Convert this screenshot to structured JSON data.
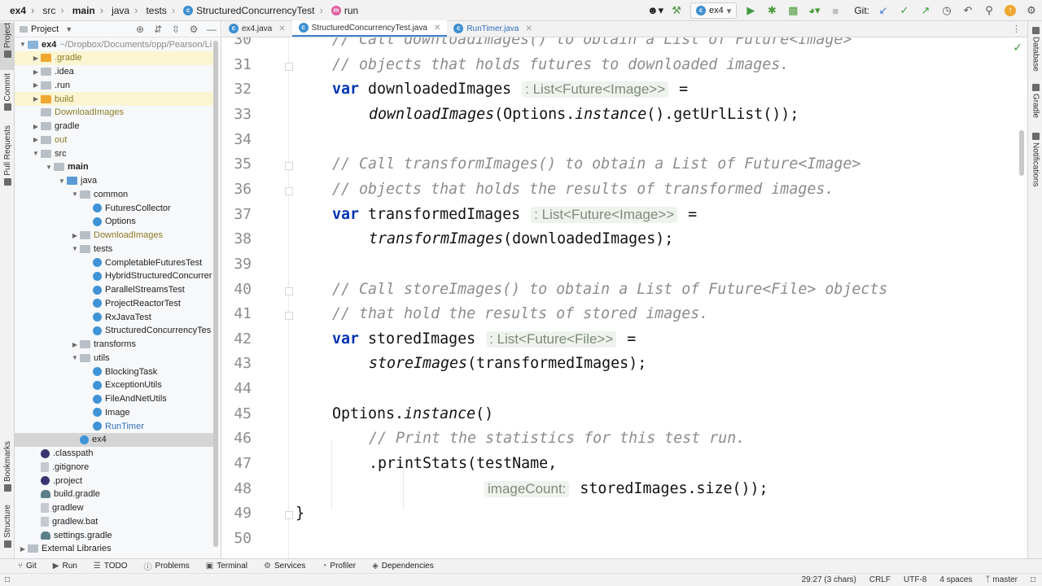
{
  "breadcrumb": [
    "ex4",
    "src",
    "main",
    "java",
    "tests",
    "StructuredConcurrencyTest",
    "run"
  ],
  "toolbar": {
    "run_config": "ex4",
    "git_label": "Git:",
    "icons": [
      "user-icon",
      "hammer-icon",
      "run-icon",
      "debug-icon",
      "coverage-icon",
      "profile-icon",
      "stop-icon",
      "git-update-icon",
      "git-commit-icon",
      "git-push-icon",
      "history-icon",
      "rollback-icon",
      "search-icon",
      "update-icon",
      "settings-icon"
    ]
  },
  "left_strip": [
    "Project",
    "Commit",
    "Pull Requests",
    "Bookmarks",
    "Structure"
  ],
  "right_strip": [
    "Database",
    "Gradle",
    "Notifications"
  ],
  "project_panel": {
    "title": "Project",
    "tree": [
      {
        "label": "ex4",
        "extra": "~/Dropbox/Documents/opp/Pearson/Li",
        "depth": 0,
        "arrow": "open",
        "icon": "folder-blue",
        "bold": true
      },
      {
        "label": ".gradle",
        "depth": 1,
        "arrow": "closed",
        "icon": "folder-orange",
        "style": "olive",
        "hl": true
      },
      {
        "label": ".idea",
        "depth": 1,
        "arrow": "closed",
        "icon": "folder-gray"
      },
      {
        "label": ".run",
        "depth": 1,
        "arrow": "closed",
        "icon": "folder-gray"
      },
      {
        "label": "build",
        "depth": 1,
        "arrow": "closed",
        "icon": "folder-orange",
        "style": "olive",
        "hl": true
      },
      {
        "label": "DownloadImages",
        "depth": 1,
        "arrow": "none",
        "icon": "folder-gray",
        "style": "olive"
      },
      {
        "label": "gradle",
        "depth": 1,
        "arrow": "closed",
        "icon": "folder-gray"
      },
      {
        "label": "out",
        "depth": 1,
        "arrow": "closed",
        "icon": "folder-gray",
        "style": "olive"
      },
      {
        "label": "src",
        "depth": 1,
        "arrow": "open",
        "icon": "folder-gray"
      },
      {
        "label": "main",
        "depth": 2,
        "arrow": "open",
        "icon": "folder-gray",
        "bold": true
      },
      {
        "label": "java",
        "depth": 3,
        "arrow": "open",
        "icon": "folder-src"
      },
      {
        "label": "common",
        "depth": 4,
        "arrow": "open",
        "icon": "folder-gray"
      },
      {
        "label": "FuturesCollector",
        "depth": 5,
        "arrow": "none",
        "icon": "class"
      },
      {
        "label": "Options",
        "depth": 5,
        "arrow": "none",
        "icon": "class"
      },
      {
        "label": "DownloadImages",
        "depth": 4,
        "arrow": "closed",
        "icon": "folder-gray",
        "style": "olive"
      },
      {
        "label": "tests",
        "depth": 4,
        "arrow": "open",
        "icon": "folder-gray"
      },
      {
        "label": "CompletableFuturesTest",
        "depth": 5,
        "arrow": "none",
        "icon": "class"
      },
      {
        "label": "HybridStructuredConcurrer",
        "depth": 5,
        "arrow": "none",
        "icon": "class"
      },
      {
        "label": "ParallelStreamsTest",
        "depth": 5,
        "arrow": "none",
        "icon": "class"
      },
      {
        "label": "ProjectReactorTest",
        "depth": 5,
        "arrow": "none",
        "icon": "class"
      },
      {
        "label": "RxJavaTest",
        "depth": 5,
        "arrow": "none",
        "icon": "class"
      },
      {
        "label": "StructuredConcurrencyTes",
        "depth": 5,
        "arrow": "none",
        "icon": "class"
      },
      {
        "label": "transforms",
        "depth": 4,
        "arrow": "closed",
        "icon": "folder-gray"
      },
      {
        "label": "utils",
        "depth": 4,
        "arrow": "open",
        "icon": "folder-gray"
      },
      {
        "label": "BlockingTask",
        "depth": 5,
        "arrow": "none",
        "icon": "class"
      },
      {
        "label": "ExceptionUtils",
        "depth": 5,
        "arrow": "none",
        "icon": "class"
      },
      {
        "label": "FileAndNetUtils",
        "depth": 5,
        "arrow": "none",
        "icon": "class"
      },
      {
        "label": "Image",
        "depth": 5,
        "arrow": "none",
        "icon": "class"
      },
      {
        "label": "RunTimer",
        "depth": 5,
        "arrow": "none",
        "icon": "class",
        "style": "blue"
      },
      {
        "label": "ex4",
        "depth": 4,
        "arrow": "none",
        "icon": "class",
        "selected": true
      },
      {
        "label": ".classpath",
        "depth": 1,
        "arrow": "none",
        "icon": "eclipse"
      },
      {
        "label": ".gitignore",
        "depth": 1,
        "arrow": "none",
        "icon": "file"
      },
      {
        "label": ".project",
        "depth": 1,
        "arrow": "none",
        "icon": "eclipse"
      },
      {
        "label": "build.gradle",
        "depth": 1,
        "arrow": "none",
        "icon": "gradle"
      },
      {
        "label": "gradlew",
        "depth": 1,
        "arrow": "none",
        "icon": "file"
      },
      {
        "label": "gradlew.bat",
        "depth": 1,
        "arrow": "none",
        "icon": "file"
      },
      {
        "label": "settings.gradle",
        "depth": 1,
        "arrow": "none",
        "icon": "gradle"
      },
      {
        "label": "External Libraries",
        "depth": 0,
        "arrow": "closed",
        "icon": "folder-gray"
      }
    ]
  },
  "tabs": [
    {
      "label": "ex4.java",
      "active": false
    },
    {
      "label": "StructuredConcurrencyTest.java",
      "active": true
    },
    {
      "label": "RunTimer.java",
      "active": false,
      "blue": true
    }
  ],
  "editor": {
    "lines": [
      {
        "n": "30",
        "indent": 1,
        "parts": [
          {
            "t": "// Call downloadImages() to obtain a List of Future<Image>",
            "c": "cmt"
          }
        ]
      },
      {
        "n": "31",
        "indent": 1,
        "parts": [
          {
            "t": "// objects that holds futures to downloaded images.",
            "c": "cmt"
          }
        ]
      },
      {
        "n": "32",
        "indent": 1,
        "parts": [
          {
            "t": "var",
            "c": "kw"
          },
          {
            "t": " downloadedImages "
          },
          {
            "t": ": List<Future<Image>>",
            "c": "hint"
          },
          {
            "t": " ="
          }
        ]
      },
      {
        "n": "33",
        "indent": 2,
        "parts": [
          {
            "t": "downloadImages",
            "c": "it"
          },
          {
            "t": "(Options."
          },
          {
            "t": "instance",
            "c": "it"
          },
          {
            "t": "().getUrlList());"
          }
        ]
      },
      {
        "n": "34",
        "indent": 0,
        "parts": []
      },
      {
        "n": "35",
        "indent": 1,
        "parts": [
          {
            "t": "// Call transformImages() to obtain a List of Future<Image>",
            "c": "cmt"
          }
        ]
      },
      {
        "n": "36",
        "indent": 1,
        "parts": [
          {
            "t": "// objects that holds the results of transformed images.",
            "c": "cmt"
          }
        ]
      },
      {
        "n": "37",
        "indent": 1,
        "parts": [
          {
            "t": "var",
            "c": "kw"
          },
          {
            "t": " transformedImages "
          },
          {
            "t": ": List<Future<Image>>",
            "c": "hint"
          },
          {
            "t": " ="
          }
        ]
      },
      {
        "n": "38",
        "indent": 2,
        "parts": [
          {
            "t": "transformImages",
            "c": "it"
          },
          {
            "t": "(downloadedImages);"
          }
        ]
      },
      {
        "n": "39",
        "indent": 0,
        "parts": []
      },
      {
        "n": "40",
        "indent": 1,
        "parts": [
          {
            "t": "// Call storeImages() to obtain a List of Future<File> objects",
            "c": "cmt"
          }
        ]
      },
      {
        "n": "41",
        "indent": 1,
        "parts": [
          {
            "t": "// that hold the results of stored images.",
            "c": "cmt"
          }
        ]
      },
      {
        "n": "42",
        "indent": 1,
        "parts": [
          {
            "t": "var",
            "c": "kw"
          },
          {
            "t": " storedImages "
          },
          {
            "t": ": List<Future<File>>",
            "c": "hint"
          },
          {
            "t": " ="
          }
        ]
      },
      {
        "n": "43",
        "indent": 2,
        "parts": [
          {
            "t": "storeImages",
            "c": "it"
          },
          {
            "t": "(transformedImages);"
          }
        ]
      },
      {
        "n": "44",
        "indent": 0,
        "parts": []
      },
      {
        "n": "45",
        "indent": 1,
        "parts": [
          {
            "t": "Options."
          },
          {
            "t": "instance",
            "c": "it"
          },
          {
            "t": "()"
          }
        ]
      },
      {
        "n": "46",
        "indent": 2,
        "parts": [
          {
            "t": "// Print the statistics for this test run.",
            "c": "cmt"
          }
        ]
      },
      {
        "n": "47",
        "indent": 2,
        "parts": [
          {
            "t": ".printStats(testName,"
          }
        ]
      },
      {
        "n": "48",
        "indent": 5,
        "parts": [
          {
            "t": "imageCount:",
            "c": "hint"
          },
          {
            "t": " storedImages.size());"
          }
        ]
      },
      {
        "n": "49",
        "indent": 0,
        "parts": [
          {
            "t": "}"
          }
        ]
      },
      {
        "n": "50",
        "indent": 0,
        "parts": []
      }
    ]
  },
  "bottom_tools": [
    {
      "icon": "git-icon",
      "label": "Git"
    },
    {
      "icon": "run-icon",
      "label": "Run"
    },
    {
      "icon": "todo-icon",
      "label": "TODO"
    },
    {
      "icon": "problems-icon",
      "label": "Problems"
    },
    {
      "icon": "terminal-icon",
      "label": "Terminal"
    },
    {
      "icon": "services-icon",
      "label": "Services"
    },
    {
      "icon": "profiler-icon",
      "label": "Profiler"
    },
    {
      "icon": "dependencies-icon",
      "label": "Dependencies"
    }
  ],
  "status": {
    "position": "29:27 (3 chars)",
    "line_sep": "CRLF",
    "encoding": "UTF-8",
    "indent": "4 spaces",
    "branch": "master"
  }
}
